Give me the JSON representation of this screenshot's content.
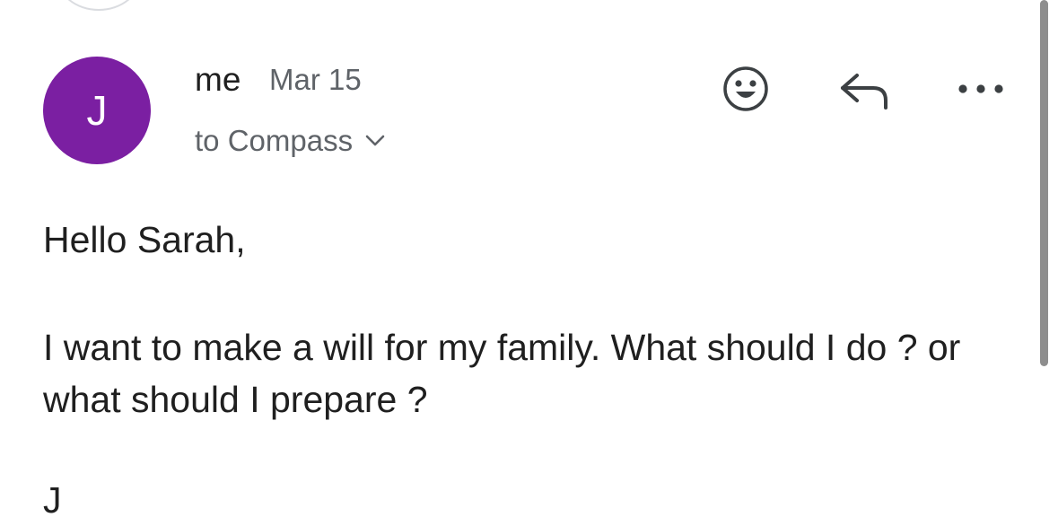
{
  "message": {
    "avatar_initial": "J",
    "avatar_color": "#7b1fa2",
    "sender": "me",
    "date": "Mar 15",
    "recipients": "to Compass",
    "body": {
      "greeting": "Hello Sarah,",
      "paragraph": "I want to make a will for my family. What should I do ?  or what should I prepare ?",
      "next_line_start": "J"
    }
  },
  "actions": {
    "emoji_icon": "smiley-icon",
    "reply_icon": "reply-arrow-icon",
    "more_icon": "more-horizontal-icon"
  },
  "colors": {
    "secondary_text": "#5f6368",
    "primary_text": "#1f1f1f"
  }
}
